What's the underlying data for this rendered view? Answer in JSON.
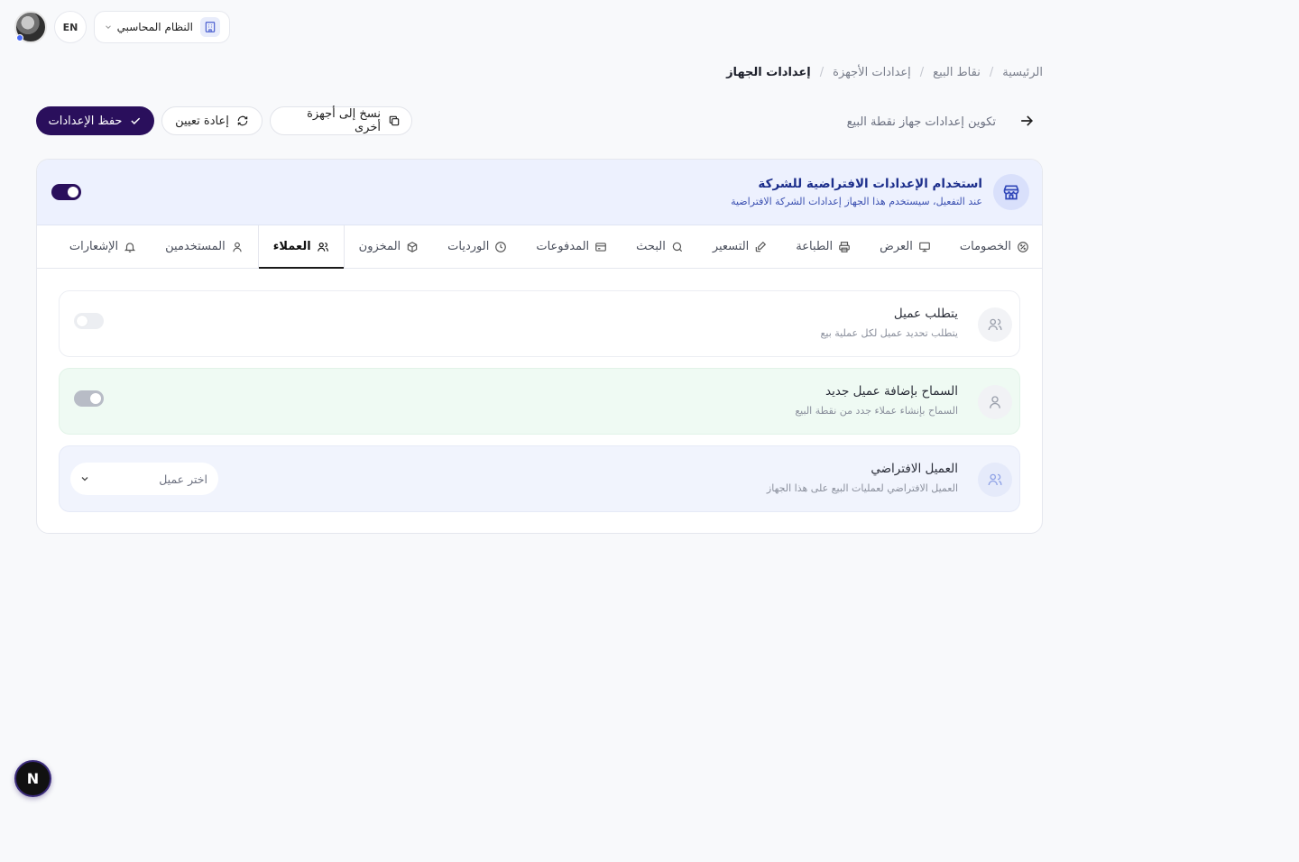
{
  "topbar": {
    "language": "EN",
    "system_label": "النظام المحاسبي"
  },
  "breadcrumb": [
    "الرئيسية",
    "نقاط البيع",
    "إعدادات الأجهزة",
    "إعدادات الجهاز"
  ],
  "header": {
    "subtitle": "تكوين إعدادات جهاز نقطة البيع",
    "copy_label": "نسخ إلى أجهزة أخرى",
    "reset_label": "إعادة تعيين",
    "save_label": "حفظ الإعدادات"
  },
  "banner": {
    "title": "استخدام الإعدادات الافتراضية للشركة",
    "description": "عند التفعيل، سيستخدم هذا الجهاز إعدادات الشركة الافتراضية",
    "enabled": true
  },
  "tabs": [
    {
      "label": "الخصومات",
      "icon": "percent-icon"
    },
    {
      "label": "العرض",
      "icon": "monitor-icon"
    },
    {
      "label": "الطباعة",
      "icon": "printer-icon"
    },
    {
      "label": "التسعير",
      "icon": "edit-icon"
    },
    {
      "label": "البحث",
      "icon": "search-icon"
    },
    {
      "label": "المدفوعات",
      "icon": "card-icon"
    },
    {
      "label": "الورديات",
      "icon": "clock-icon"
    },
    {
      "label": "المخزون",
      "icon": "box-icon"
    },
    {
      "label": "العملاء",
      "icon": "users-icon",
      "active": true
    },
    {
      "label": "المستخدمين",
      "icon": "user-icon"
    },
    {
      "label": "الإشعارات",
      "icon": "bell-icon"
    }
  ],
  "settings": {
    "require_customer": {
      "title": "يتطلب عميل",
      "description": "يتطلب تحديد عميل لكل عملية بيع",
      "enabled": false
    },
    "allow_new_customer": {
      "title": "السماح بإضافة عميل جديد",
      "description": "السماح بإنشاء عملاء جدد من نقطة البيع",
      "enabled": true
    },
    "default_customer": {
      "title": "العميل الافتراضي",
      "description": "العميل الافتراضي لعمليات البيع على هذا الجهاز",
      "placeholder": "اختر عميل"
    }
  },
  "fab": {
    "label": "N"
  },
  "colors": {
    "primary": "#2a0f5c",
    "banner_bg": "#edf1fe",
    "banner_text": "#1d2f8c"
  }
}
